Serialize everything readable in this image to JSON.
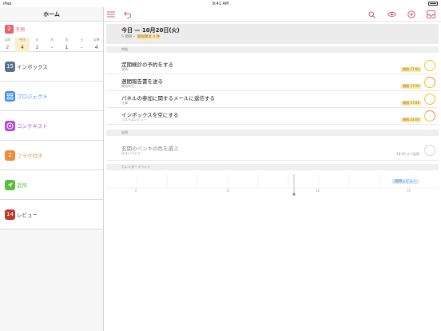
{
  "status_bar": {
    "device": "iPad",
    "wifi": "wifi-icon",
    "time": "9:41 AM",
    "battery": "battery-icon"
  },
  "sidebar": {
    "title": "ホーム",
    "forecast": {
      "count": "2",
      "label": "予測",
      "days": [
        {
          "name": "以前",
          "value": "2",
          "style": "red"
        },
        {
          "name": "今日",
          "value": "4",
          "style": "today"
        },
        {
          "name": "水",
          "value": "2",
          "style": "red"
        },
        {
          "name": "木",
          "value": "-",
          "style": ""
        },
        {
          "name": "金",
          "value": "1",
          "style": ""
        },
        {
          "name": "土",
          "value": "-",
          "style": ""
        },
        {
          "name": "以降",
          "value": "4",
          "style": ""
        }
      ]
    },
    "items": [
      {
        "id": "inbox",
        "badge": "15",
        "label": "インボックス",
        "color": "#5b6f8f",
        "label_color": "#444"
      },
      {
        "id": "projects",
        "badge": "",
        "label": "プロジェクト",
        "color": "#3d8ef0",
        "label_color": "#3d8ef0"
      },
      {
        "id": "contexts",
        "badge": "",
        "label": "コンテキスト",
        "color": "#b14bd9",
        "label_color": "#b14bd9"
      },
      {
        "id": "flagged",
        "badge": "2",
        "label": "フラグ付き",
        "color": "#f08a3c",
        "label_color": "#f08a3c"
      },
      {
        "id": "nearby",
        "badge": "",
        "label": "近所",
        "color": "#5bbe3a",
        "label_color": "#5bbe3a"
      },
      {
        "id": "review",
        "badge": "14",
        "label": "レビュー",
        "color": "#c03a2b",
        "label_color": "#444"
      }
    ]
  },
  "toolbar": {
    "left_icons": [
      "sidebar-list-icon",
      "undo-icon"
    ],
    "right_icons": [
      "search-icon",
      "eye-icon",
      "add-icon",
      "inbox-tray-icon"
    ]
  },
  "main": {
    "header_title": "今日 — 10月20日(火)",
    "header_sub_count": "5 項目",
    "header_sub_due": "期限間近 4 件",
    "sections": {
      "due": "期限",
      "deferred": "延期",
      "calendar": "カレンダーイベント"
    },
    "tasks": [
      {
        "title": "定期検診の予約をする",
        "context": "健康",
        "due": "期限 17:00",
        "flag": false
      },
      {
        "title": "週間報告書を送る",
        "context": "業務状況",
        "due": "期限 17:00",
        "flag": true
      },
      {
        "title": "パネルの参加に関するメールに返信する",
        "context": "仕事",
        "due": "期限 17:00",
        "flag": false
      },
      {
        "title": "インボックスを空にする",
        "context": "システムレビュー",
        "due": "期限 23:00",
        "flag": true
      }
    ],
    "deferred_tasks": [
      {
        "title": "玄関のペンキの色を選ぶ",
        "context": "住まいづくり",
        "due": "18:00 まで延期"
      }
    ],
    "calendar": {
      "event": "週間レビュー",
      "hours": [
        "6",
        "11",
        "16",
        "19"
      ]
    }
  }
}
